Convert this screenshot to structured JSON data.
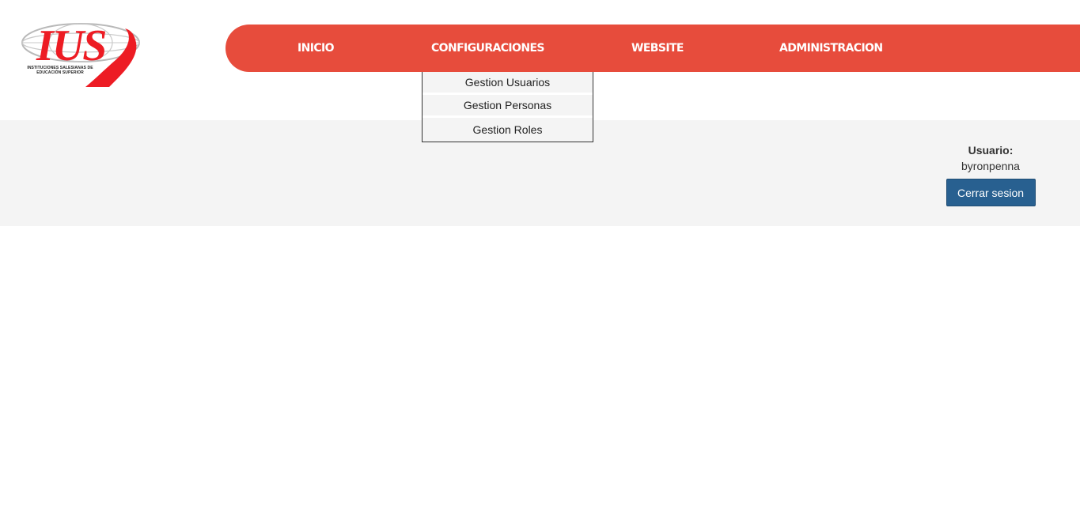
{
  "logo": {
    "text": "IUS",
    "caption_line1": "INSTITUCIONES SALESIANAS DE",
    "caption_line2": "EDUCACIÓN SUPERIOR",
    "brand_color": "#ed1c24"
  },
  "navbar": {
    "color": "#e74c3c",
    "items": [
      {
        "label": "INICIO"
      },
      {
        "label": "CONFIGURACIONES"
      },
      {
        "label": "WEBSITE"
      },
      {
        "label": "ADMINISTRACION"
      }
    ]
  },
  "dropdown": {
    "items": [
      {
        "label": "Gestion Usuarios"
      },
      {
        "label": "Gestion Personas"
      },
      {
        "label": "Gestion Roles"
      }
    ]
  },
  "user_panel": {
    "label": "Usuario:",
    "username": "byronpenna",
    "logout_label": "Cerrar sesion",
    "button_color": "#286090"
  }
}
